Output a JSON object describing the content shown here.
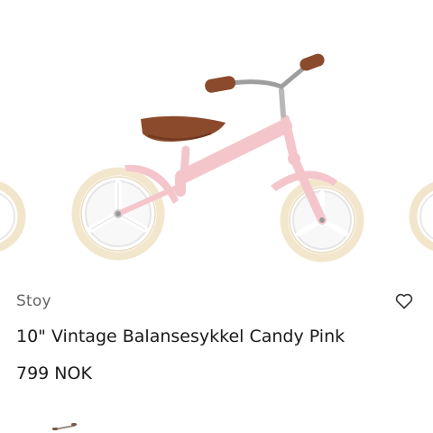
{
  "product": {
    "brand": "Stoy",
    "title": "10\" Vintage Balansesykkel Candy Pink",
    "price": "799 NOK",
    "frame_color": "#f4c6cc",
    "tire_color": "#f4ead2",
    "saddle_color": "#8b4a2b"
  },
  "icons": {
    "wishlist": "heart-outline-icon"
  }
}
